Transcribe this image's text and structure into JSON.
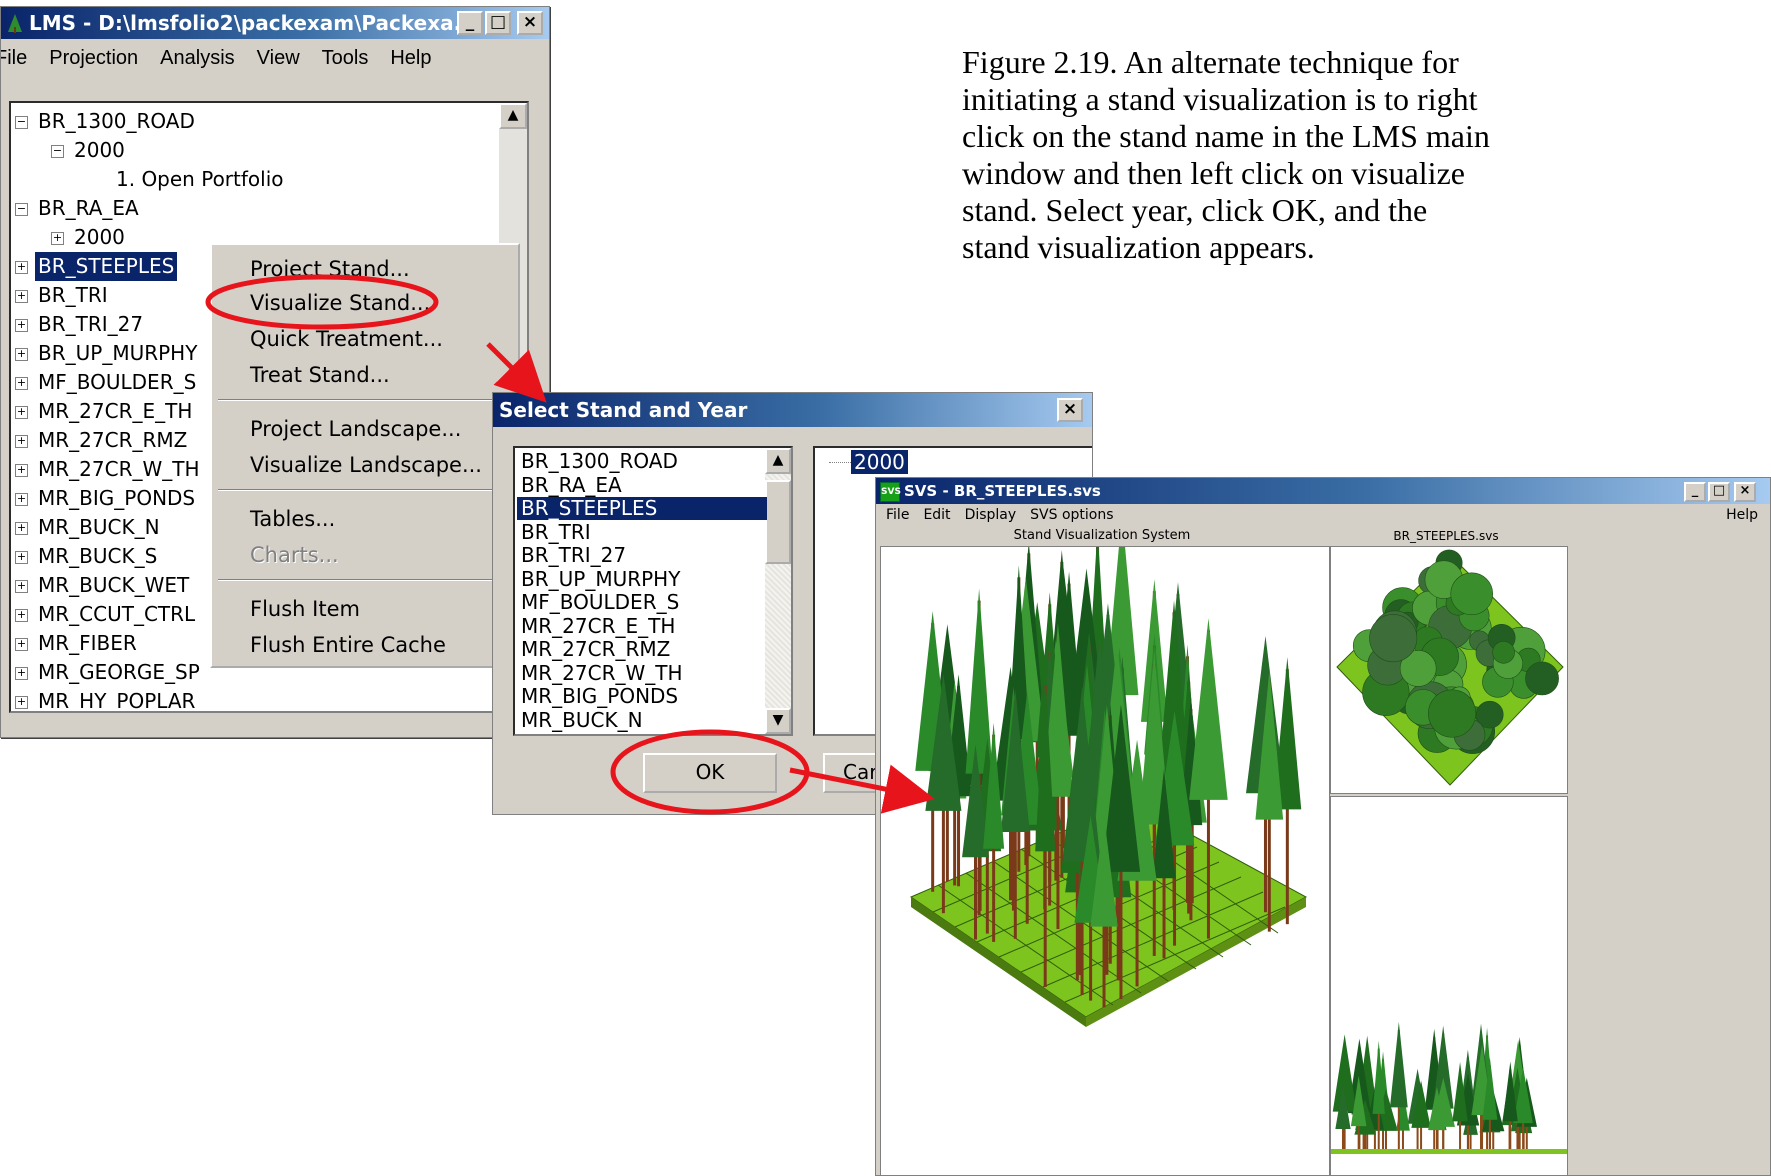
{
  "colors": {
    "title_blue": "#0a246a",
    "selection": "#0a246a",
    "highlight_red": "#e8141c",
    "ground": "#7ec41e",
    "tree_green": "#1e6e1e"
  },
  "lms_window": {
    "title": "LMS - D:\\lmsfolio2\\packexam\\Packexa...",
    "menu": [
      "File",
      "Projection",
      "Analysis",
      "View",
      "Tools",
      "Help"
    ],
    "tree": [
      {
        "label": "BR_1300_ROAD",
        "indent": 0,
        "sign": "−"
      },
      {
        "label": "2000",
        "indent": 1,
        "sign": "−"
      },
      {
        "label": "1. Open Portfolio",
        "indent": 2,
        "sign": ""
      },
      {
        "label": "BR_RA_EA",
        "indent": 0,
        "sign": "−"
      },
      {
        "label": "2000",
        "indent": 1,
        "sign": "+"
      },
      {
        "label": "BR_STEEPLES",
        "indent": 0,
        "sign": "+",
        "selected": true
      },
      {
        "label": "BR_TRI",
        "indent": 0,
        "sign": "+"
      },
      {
        "label": "BR_TRI_27",
        "indent": 0,
        "sign": "+"
      },
      {
        "label": "BR_UP_MURPHY",
        "indent": 0,
        "sign": "+"
      },
      {
        "label": "MF_BOULDER_S",
        "indent": 0,
        "sign": "+"
      },
      {
        "label": "MR_27CR_E_TH",
        "indent": 0,
        "sign": "+"
      },
      {
        "label": "MR_27CR_RMZ",
        "indent": 0,
        "sign": "+"
      },
      {
        "label": "MR_27CR_W_TH",
        "indent": 0,
        "sign": "+"
      },
      {
        "label": "MR_BIG_PONDS",
        "indent": 0,
        "sign": "+"
      },
      {
        "label": "MR_BUCK_N",
        "indent": 0,
        "sign": "+"
      },
      {
        "label": "MR_BUCK_S",
        "indent": 0,
        "sign": "+"
      },
      {
        "label": "MR_BUCK_WET",
        "indent": 0,
        "sign": "+"
      },
      {
        "label": "MR_CCUT_CTRL",
        "indent": 0,
        "sign": "+"
      },
      {
        "label": "MR_FIBER",
        "indent": 0,
        "sign": "+"
      },
      {
        "label": "MR_GEORGE_SP",
        "indent": 0,
        "sign": "+"
      },
      {
        "label": "MR_HY_POPLAR",
        "indent": 0,
        "sign": "+"
      }
    ]
  },
  "context_menu": {
    "items": [
      {
        "label": "Project Stand...",
        "disabled": false
      },
      {
        "label": "Visualize Stand...",
        "disabled": false
      },
      {
        "label": "Quick Treatment...",
        "disabled": false
      },
      {
        "label": "Treat Stand...",
        "disabled": false
      },
      {
        "label": "Project Landscape...",
        "disabled": false
      },
      {
        "label": "Visualize Landscape...",
        "disabled": false
      },
      {
        "label": "Tables...",
        "disabled": false
      },
      {
        "label": "Charts...",
        "disabled": true
      },
      {
        "label": "Flush Item",
        "disabled": false
      },
      {
        "label": "Flush Entire Cache",
        "disabled": false
      }
    ]
  },
  "select_dialog": {
    "title": "Select Stand and Year",
    "stands": [
      "BR_1300_ROAD",
      "BR_RA_EA",
      "BR_STEEPLES",
      "BR_TRI",
      "BR_TRI_27",
      "BR_UP_MURPHY",
      "MF_BOULDER_S",
      "MR_27CR_E_TH",
      "MR_27CR_RMZ",
      "MR_27CR_W_TH",
      "MR_BIG_PONDS",
      "MR_BUCK_N"
    ],
    "selected_stand": "BR_STEEPLES",
    "year": "2000",
    "ok_label": "OK",
    "cancel_label": "Car"
  },
  "svs_window": {
    "title": "SVS - BR_STEEPLES.svs",
    "menu": [
      "File",
      "Edit",
      "Display",
      "SVS options"
    ],
    "help": "Help",
    "main_label": "Stand Visualization System",
    "side_label": "BR_STEEPLES.svs"
  },
  "caption_lines": [
    "Figure 2.19.  An alternate technique for",
    "initiating a stand visualization is to right",
    "click on the stand name in the LMS main",
    "window and then left click on visualize",
    "stand.  Select year, click OK, and the",
    "stand visualization appears."
  ]
}
